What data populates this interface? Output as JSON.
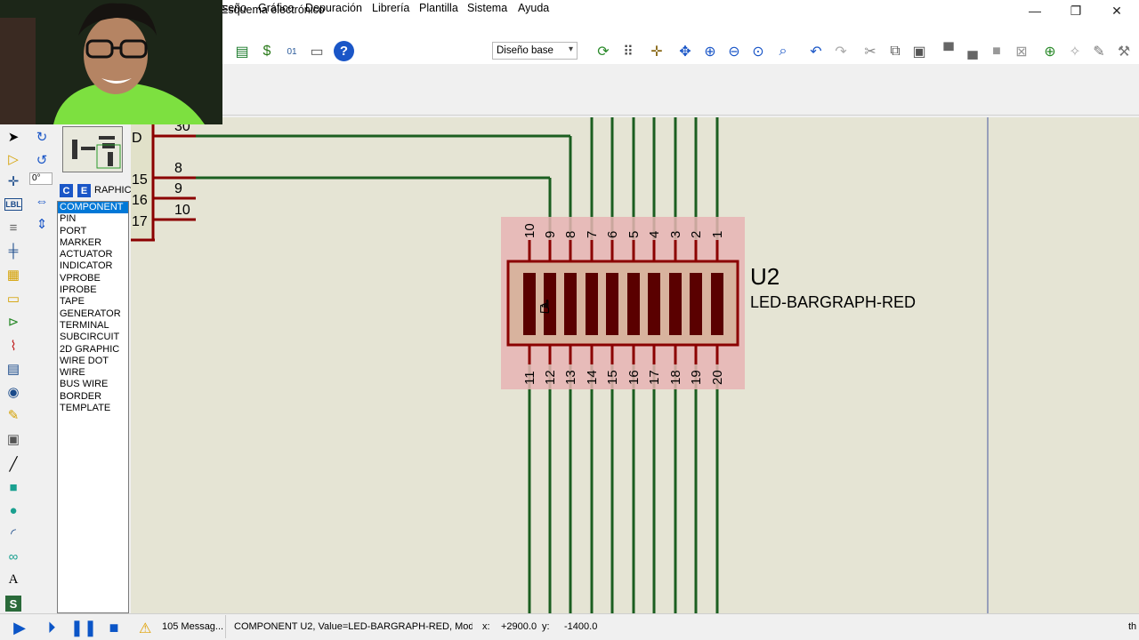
{
  "window": {
    "title": "Esquema electrónico",
    "minimize": "—",
    "restore": "❐",
    "close": "✕"
  },
  "menu": {
    "items": [
      "seño",
      "Gráfico",
      "Depuración",
      "Librería",
      "Plantilla",
      "Sistema",
      "Ayuda"
    ]
  },
  "toolbar": {
    "design_select": "Diseño base",
    "help_glyph": "?"
  },
  "left_panel": {
    "angle": "0°",
    "mode_c": "C",
    "mode_e": "E",
    "header_label": "RAPHIC",
    "items": [
      "COMPONENT",
      "PIN",
      "PORT",
      "MARKER",
      "ACTUATOR",
      "INDICATOR",
      "VPROBE",
      "IPROBE",
      "TAPE",
      "GENERATOR",
      "TERMINAL",
      "SUBCIRCUIT",
      "2D GRAPHIC",
      "WIRE DOT",
      "WIRE",
      "BUS WIRE",
      "BORDER",
      "TEMPLATE"
    ],
    "selected_index": 0
  },
  "schematic": {
    "left_part_labels": [
      "D",
      "15",
      "16",
      "17"
    ],
    "left_part_pins": [
      "30",
      "8",
      "9",
      "10"
    ],
    "component_ref": "U2",
    "component_value": "LED-BARGRAPH-RED",
    "top_pins": [
      "10",
      "9",
      "8",
      "7",
      "6",
      "5",
      "4",
      "3",
      "2",
      "1"
    ],
    "bottom_pins": [
      "11",
      "12",
      "13",
      "14",
      "15",
      "16",
      "17",
      "18",
      "19",
      "20"
    ]
  },
  "status": {
    "messages": "105 Messag...",
    "component_info": "COMPONENT U2, Value=LED-BARGRAPH-RED, Modu",
    "x_label": "x:",
    "x_value": "+2900.0",
    "y_label": "y:",
    "y_value": "-1400.0",
    "right_text": "th"
  },
  "colors": {
    "wire": "#1b5e20",
    "part": "#8b0000",
    "highlight": "#e8b4b4",
    "canvas": "#e5e4d4"
  }
}
